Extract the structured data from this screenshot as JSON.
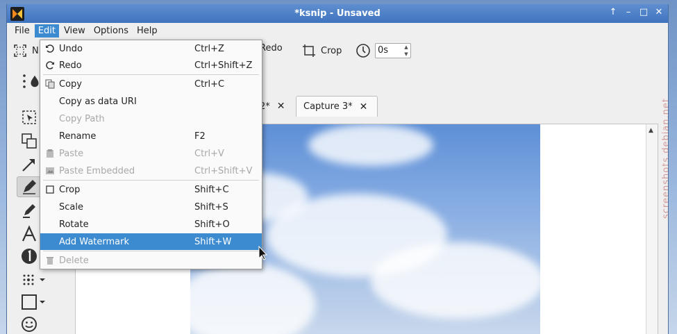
{
  "window": {
    "title": "*ksnip - Unsaved",
    "controls": [
      "↑",
      "–",
      "□",
      "✕"
    ],
    "accent_color": "#3c8bd0"
  },
  "menubar": {
    "items": [
      "File",
      "Edit",
      "View",
      "Options",
      "Help"
    ],
    "active": "Edit"
  },
  "toolbar": {
    "new_label": "N",
    "redo_label": "Redo",
    "crop_label": "Crop",
    "delay_value": "0s"
  },
  "tools": [
    "select-dots-icon",
    "droplet-icon",
    "selection-icon",
    "duplicate-icon",
    "arrow-icon",
    "pen-icon",
    "marker-icon",
    "text-icon",
    "number-icon",
    "blur-icon",
    "rectangle-icon",
    "sticker-icon"
  ],
  "tabs": [
    {
      "label": "2*",
      "close": "✕"
    },
    {
      "label": "Capture 3*",
      "close": "✕"
    }
  ],
  "edit_menu": {
    "items": [
      {
        "label": "Undo",
        "shortcut": "Ctrl+Z",
        "icon": "undo-icon",
        "enabled": true
      },
      {
        "label": "Redo",
        "shortcut": "Ctrl+Shift+Z",
        "icon": "redo-icon",
        "enabled": true
      },
      {
        "label": "Copy",
        "shortcut": "Ctrl+C",
        "icon": "copy-icon",
        "enabled": true
      },
      {
        "label": "Copy as data URI",
        "shortcut": "",
        "icon": "",
        "enabled": true
      },
      {
        "label": "Copy Path",
        "shortcut": "",
        "icon": "",
        "enabled": false
      },
      {
        "label": "Rename",
        "shortcut": "F2",
        "icon": "",
        "enabled": true
      },
      {
        "label": "Paste",
        "shortcut": "Ctrl+V",
        "icon": "paste-icon",
        "enabled": false
      },
      {
        "label": "Paste Embedded",
        "shortcut": "Ctrl+Shift+V",
        "icon": "paste-embedded-icon",
        "enabled": false
      },
      {
        "label": "Crop",
        "shortcut": "Shift+C",
        "icon": "crop-icon",
        "enabled": true
      },
      {
        "label": "Scale",
        "shortcut": "Shift+S",
        "icon": "",
        "enabled": true
      },
      {
        "label": "Rotate",
        "shortcut": "Shift+O",
        "icon": "",
        "enabled": true
      },
      {
        "label": "Add Watermark",
        "shortcut": "Shift+W",
        "icon": "",
        "enabled": true,
        "highlighted": true
      },
      {
        "label": "Delete",
        "shortcut": "",
        "icon": "trash-icon",
        "enabled": false
      }
    ]
  },
  "watermark": "screenshots.debian.net"
}
